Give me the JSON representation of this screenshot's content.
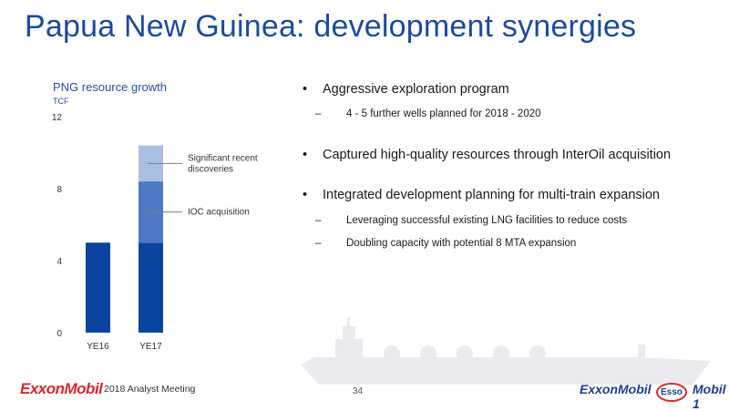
{
  "header": {
    "title": "Papua New Guinea: development synergies"
  },
  "chart_data": {
    "type": "bar",
    "title": "PNG resource growth",
    "ylabel": "TCF",
    "ylim": [
      0,
      12
    ],
    "yticks": [
      "0",
      "4",
      "8",
      "12"
    ],
    "categories": [
      "YE16",
      "YE17"
    ],
    "series": [
      {
        "values": [
          5.0,
          5.0
        ],
        "color": "#0b44a0"
      },
      {
        "values": [
          0,
          3.4
        ],
        "color": "#4f79c2"
      },
      {
        "values": [
          0,
          2.0
        ],
        "color": "#a9bfe3"
      }
    ],
    "annotations": [
      "Significant recent\ndiscoveries",
      "IOC acquisition"
    ],
    "grid": false,
    "legend": "none"
  },
  "bullets": [
    {
      "text": "Aggressive exploration program",
      "subs": [
        "4 - 5 further wells planned for 2018 - 2020"
      ]
    },
    {
      "text": "Captured high-quality resources through InterOil acquisition",
      "subs": []
    },
    {
      "text": "Integrated development planning for multi-train expansion",
      "subs": [
        "Leveraging successful existing LNG facilities to reduce costs",
        "Doubling capacity with potential 8 MTA expansion"
      ]
    }
  ],
  "footer": {
    "logo": "ExxonMobil",
    "meeting": "2018 Analyst Meeting",
    "page": "34",
    "brands": [
      "Exxon",
      "Mobil",
      "Esso",
      "Mobil 1"
    ]
  },
  "colors": {
    "title": "#1e4a9c",
    "accent_red": "#d7282f"
  }
}
